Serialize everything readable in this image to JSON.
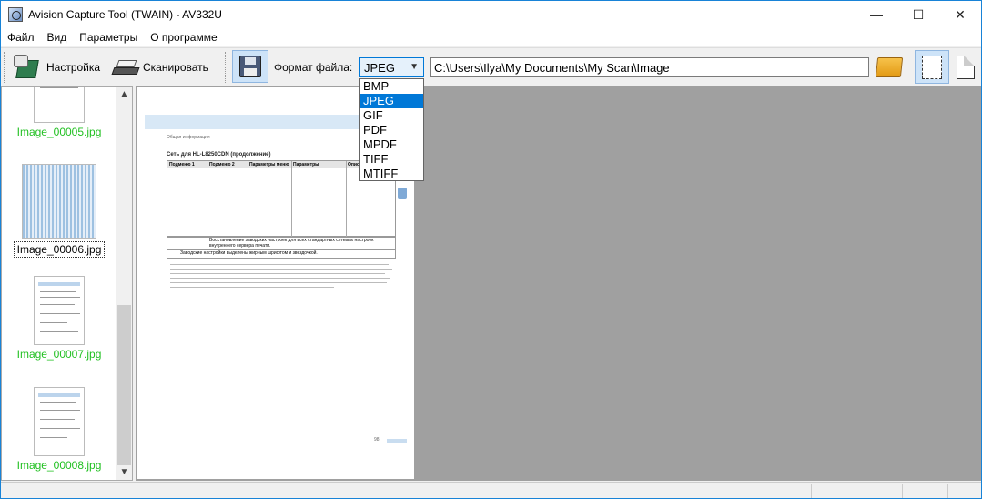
{
  "window": {
    "title": "Avision Capture Tool (TWAIN) - AV332U",
    "minimize": "—",
    "maximize": "☐",
    "close": "✕"
  },
  "menu": [
    "Файл",
    "Вид",
    "Параметры",
    "О программе"
  ],
  "toolbar": {
    "settings_label": "Настройка",
    "scan_label": "Сканировать",
    "format_label": "Формат файла:",
    "format_value": "JPEG",
    "path_value": "C:\\Users\\Ilya\\My Documents\\My Scan\\Image"
  },
  "format_options": [
    "BMP",
    "JPEG",
    "GIF",
    "PDF",
    "MPDF",
    "TIFF",
    "MTIFF"
  ],
  "format_selected": "JPEG",
  "thumbnails": [
    {
      "caption": "Image_00005.jpg",
      "selected": false
    },
    {
      "caption": "Image_00006.jpg",
      "selected": true
    },
    {
      "caption": "Image_00007.jpg",
      "selected": false
    },
    {
      "caption": "Image_00008.jpg",
      "selected": false
    }
  ],
  "preview_page": {
    "header_small": "Общая информация",
    "section_title": "Сеть для HL-L8250CDN (продолжение)",
    "columns": [
      "Подменю 1",
      "Подменю 2",
      "Параметры меню",
      "Параметры",
      "Описание"
    ],
    "row2_text": "Восстановление заводских настроек для всех стандартных сетевых настроек внутреннего сервера печати.",
    "note_text": "Заводские настройки выделены жирным шрифтом и звездочкой.",
    "page_number": "98"
  },
  "colors": {
    "accent": "#0078d7",
    "thumb_caption": "#22c022",
    "preview_bg": "#a0a0a0"
  }
}
